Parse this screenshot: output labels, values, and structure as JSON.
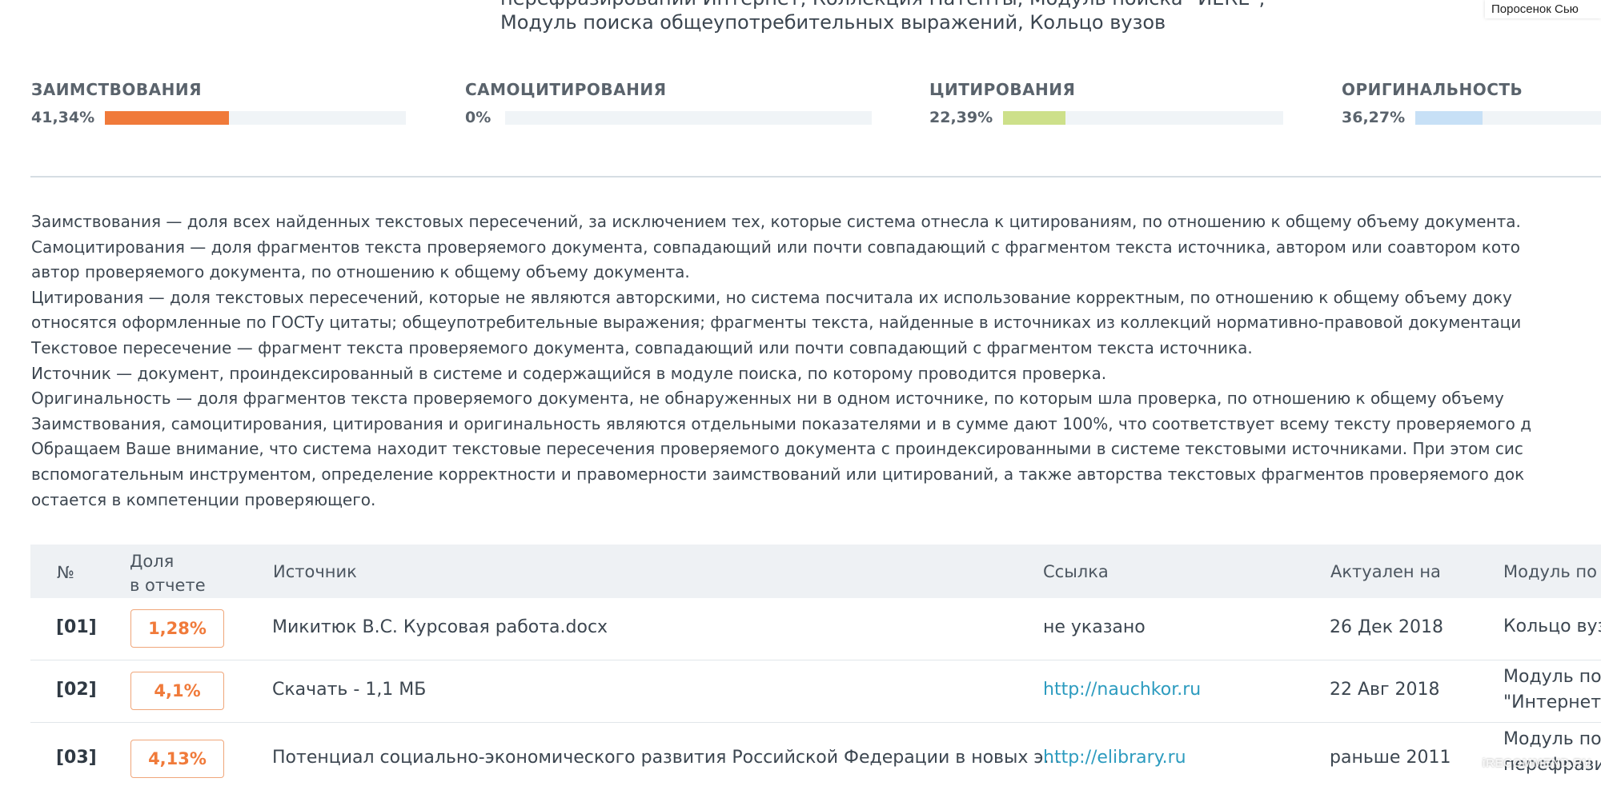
{
  "header": {
    "line1": "перефразирований Интернет, Коллекция Патенты, Модуль поиска \"ИЕКЕ\",",
    "line2": "Модуль поиска общеупотребительных выражений, Кольцо вузов",
    "username": "Поросенок Сью"
  },
  "metrics": [
    {
      "label": "ЗАИМСТВОВАНИЯ",
      "value": "41,34%",
      "percent": 41.34,
      "color": "#f07a3a"
    },
    {
      "label": "САМОЦИТИРОВАНИЯ",
      "value": "0%",
      "percent": 0,
      "color": "#f07a3a"
    },
    {
      "label": "ЦИТИРОВАНИЯ",
      "value": "22,39%",
      "percent": 22.39,
      "color": "#cde08a"
    },
    {
      "label": "ОРИГИНАЛЬНОСТЬ",
      "value": "36,27%",
      "percent": 36.27,
      "color": "#c7e0f6"
    }
  ],
  "description": [
    "Заимствования — доля всех найденных текстовых пересечений, за исключением тех, которые система отнесла к цитированиям, по отношению к общему объему документа.",
    "Самоцитирования — доля фрагментов текста проверяемого документа, совпадающий или почти совпадающий с фрагментом текста источника, автором или соавтором кото",
    "автор проверяемого документа, по отношению к общему объему документа.",
    "Цитирования — доля текстовых пересечений, которые не являются авторскими, но система посчитала их использование корректным, по отношению к общему объему доку",
    "относятся оформленные по ГОСТу цитаты; общеупотребительные выражения; фрагменты текста, найденные в источниках из коллекций нормативно-правовой документаци",
    "Текстовое пересечение — фрагмент текста проверяемого документа, совпадающий или почти совпадающий с фрагментом текста источника.",
    "Источник — документ, проиндексированный в системе и содержащийся в модуле поиска, по которому проводится проверка.",
    "Оригинальность — доля фрагментов текста проверяемого документа, не обнаруженных ни в одном источнике, по которым шла проверка, по отношению к общему объему",
    "Заимствования, самоцитирования, цитирования и оригинальность являются отдельными показателями и в сумме дают 100%, что соответствует всему тексту проверяемого д",
    "Обращаем Ваше внимание, что система находит текстовые пересечения проверяемого документа с проиндексированными в системе текстовыми источниками. При этом сис",
    "вспомогательным инструментом, определение корректности и правомерности заимствований или цитирований, а также авторства текстовых фрагментов проверяемого док",
    "остается в компетенции проверяющего."
  ],
  "table": {
    "headers": {
      "num": "№",
      "share_line1": "Доля",
      "share_line2": "в отчете",
      "source": "Источник",
      "link": "Ссылка",
      "date": "Актуален на",
      "module": "Модуль по"
    },
    "rows": [
      {
        "num": "[01]",
        "share": "1,28%",
        "source": "Микитюк В.С. Курсовая работа.docx",
        "link": "не указано",
        "date": "26 Дек 2018",
        "module1": "Кольцо вуз",
        "module2": ""
      },
      {
        "num": "[02]",
        "share": "4,1%",
        "source": "Скачать - 1,1 МБ",
        "link": "http://nauchkor.ru",
        "date": "22 Авг 2018",
        "module1": "Модуль по",
        "module2": "\"Интернет"
      },
      {
        "num": "[03]",
        "share": "4,13%",
        "source": "Потенциал социально-экономического развития Российской Федерации в новых э...",
        "link": "http://elibrary.ru",
        "date": "раньше 2011",
        "module1": "Модуль по",
        "module2": "перефрази"
      }
    ]
  },
  "watermark": "iRECOMMEND.RU"
}
